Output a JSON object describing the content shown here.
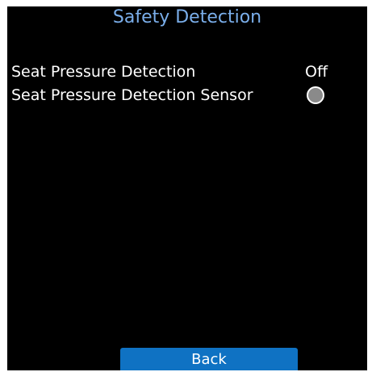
{
  "screen": {
    "title": "Safety Detection"
  },
  "settings": [
    {
      "label": "Seat Pressure Detection",
      "value": "Off"
    },
    {
      "label": "Seat Pressure Detection Sensor",
      "indicator": "grey-circle-icon",
      "indicator_color": "#8a8a8a"
    }
  ],
  "footer": {
    "back_label": "Back"
  },
  "colors": {
    "background": "#000000",
    "title": "#7aaeea",
    "text": "#ffffff",
    "button": "#0f72c3"
  }
}
